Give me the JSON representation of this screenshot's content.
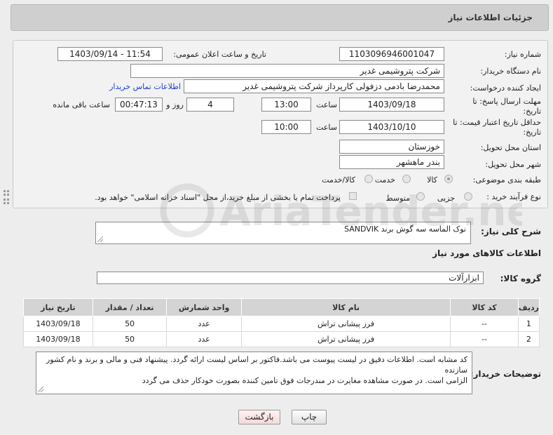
{
  "header": {
    "title": "جزئیات اطلاعات نیاز"
  },
  "form": {
    "need_number_label": "شماره نیاز:",
    "need_number": "1103096946001047",
    "announce_label": "تاریخ و ساعت اعلان عمومی:",
    "announce_value": "1403/09/14 - 11:54",
    "buyer_org_label": "نام دستگاه خریدار:",
    "buyer_org": "شرکت پتروشیمی غدیر",
    "requester_label": "ایجاد کننده درخواست:",
    "requester": "محمدرضا بادمی دزفولی کارپرداز شرکت پتروشیمی غدیر",
    "contact_link": "اطلاعات تماس خریدار",
    "deadline_label_1": "مهلت ارسال پاسخ: تا",
    "deadline_label_2": "تاریخ:",
    "deadline_date": "1403/09/18",
    "time_label": "ساعت",
    "deadline_time": "13:00",
    "days_value": "4",
    "days_label": "روز و",
    "remaining_time": "00:47:13",
    "remaining_label": "ساعت باقی مانده",
    "validity_label_1": "حداقل تاریخ اعتبار قیمت: تا",
    "validity_label_2": "تاریخ:",
    "validity_date": "1403/10/10",
    "validity_time": "10:00",
    "province_label": "استان محل تحویل:",
    "province": "خوزستان",
    "city_label": "شهر محل تحویل:",
    "city": "بندر ماهشهر",
    "category_label": "طبقه بندی موضوعی:",
    "category_options": [
      "کالا",
      "خدمت",
      "کالا/خدمت"
    ],
    "process_label": "نوع فرآیند خرید :",
    "process_options": [
      "جزیی",
      "متوسط"
    ],
    "payment_note": "پرداخت تمام یا بخشی از مبلغ خرید،از محل \"اسناد خزانه اسلامی\" خواهد بود."
  },
  "summary": {
    "label": "شرح کلی نیاز:",
    "text": "نوک الماسه سه گوش برند SANDVIK"
  },
  "goods_section": {
    "title": "اطلاعات کالاهای مورد نیاز",
    "group_label": "گروه کالا:",
    "group_value": "ابزارآلات"
  },
  "table": {
    "headers": [
      "ردیف",
      "کد کالا",
      "نام کالا",
      "واحد شمارش",
      "تعداد / مقدار",
      "تاریخ نیاز"
    ],
    "rows": [
      [
        "1",
        "--",
        "فرز پیشانی تراش",
        "عدد",
        "50",
        "1403/09/18"
      ],
      [
        "2",
        "--",
        "فرز پیشانی تراش",
        "عدد",
        "50",
        "1403/09/18"
      ]
    ]
  },
  "buyer_notes": {
    "label": "توضیحات خریدار:",
    "lines": [
      "کد مشابه است. اطلاعات دقیق در لیست پیوست می باشد.فاکتور بر اساس لیست ارائه گردد. پیشنهاد فنی و مالی و برند و نام کشور سازنده",
      "الزامی است. در صورت مشاهده مغایرت در مندرجات فوق تامین کننده بصورت خودکار حذف می گردد"
    ]
  },
  "buttons": {
    "print": "چاپ",
    "back": "بازگشت"
  },
  "watermark": {
    "text": "AriaTender.net"
  }
}
